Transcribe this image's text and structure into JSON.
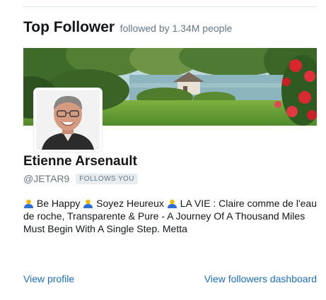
{
  "card": {
    "title": "Top Follower",
    "subtitle": "followed by 1.34M people"
  },
  "profile": {
    "name": "Etienne Arsenault",
    "handle": "@JETAR9",
    "follows_badge": "FOLLOWS YOU",
    "bio_segments": [
      "Be Happy",
      "Soyez Heureux",
      "LA VIE : Claire comme de l'eau de roche, Transparente & Pure - A Journey Of A Thousand Miles Must Begin With A Single Step. Metta"
    ],
    "bio_icon": "person-emoji-icon"
  },
  "links": {
    "view_profile": "View profile",
    "view_dashboard": "View followers dashboard"
  },
  "colors": {
    "link": "#1b6fc6",
    "muted": "#657786",
    "badge_bg": "#e6ecf0"
  }
}
